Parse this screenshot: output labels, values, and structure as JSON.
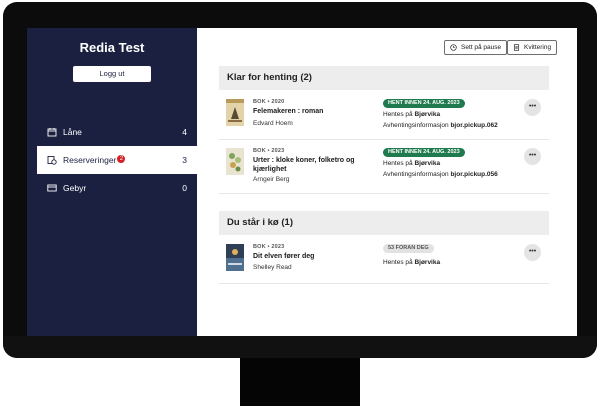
{
  "sidebar": {
    "user_name": "Redia Test",
    "logout_label": "Logg ut",
    "items": [
      {
        "label": "Låne",
        "count": "4",
        "icon": "calendar-icon"
      },
      {
        "label": "Reserveringer",
        "count": "3",
        "badge": "2",
        "icon": "reservation-icon"
      },
      {
        "label": "Gebyr",
        "count": "0",
        "icon": "card-icon"
      }
    ]
  },
  "toolbar": {
    "pause_label": "Sett på pause",
    "receipt_label": "Kvittering"
  },
  "sections": {
    "ready": {
      "title": "Klar for henting (2)",
      "items": [
        {
          "type": "BOK • 2020",
          "title": "Felemakeren : roman",
          "author": "Edvard Hoem",
          "badge": "HENT INNEN 24. AUG. 2023",
          "pickup_prefix": "Hentes på ",
          "pickup_branch": "Bjørvika",
          "code_prefix": "Avhentingsinformasjon ",
          "code": "bjor.pickup.062",
          "more": "•••"
        },
        {
          "type": "BOK • 2023",
          "title": "Urter : kloke koner, folketro og kjærlighet",
          "author": "Arngeir Berg",
          "badge": "HENT INNEN 24. AUG. 2023",
          "pickup_prefix": "Hentes på ",
          "pickup_branch": "Bjørvika",
          "code_prefix": "Avhentingsinformasjon ",
          "code": "bjor.pickup.056",
          "more": "•••"
        }
      ]
    },
    "queue": {
      "title": "Du står i kø (1)",
      "items": [
        {
          "type": "BOK • 2023",
          "title": "Dit elven fører deg",
          "author": "Shelley Read",
          "badge": "53 FORAN DEG",
          "pickup_prefix": "Hentes på ",
          "pickup_branch": "Bjørvika",
          "more": "•••"
        }
      ]
    }
  },
  "colors": {
    "sidebar_bg": "#1c2040",
    "badge_green": "#1f7a4d",
    "notification_red": "#d32027"
  }
}
